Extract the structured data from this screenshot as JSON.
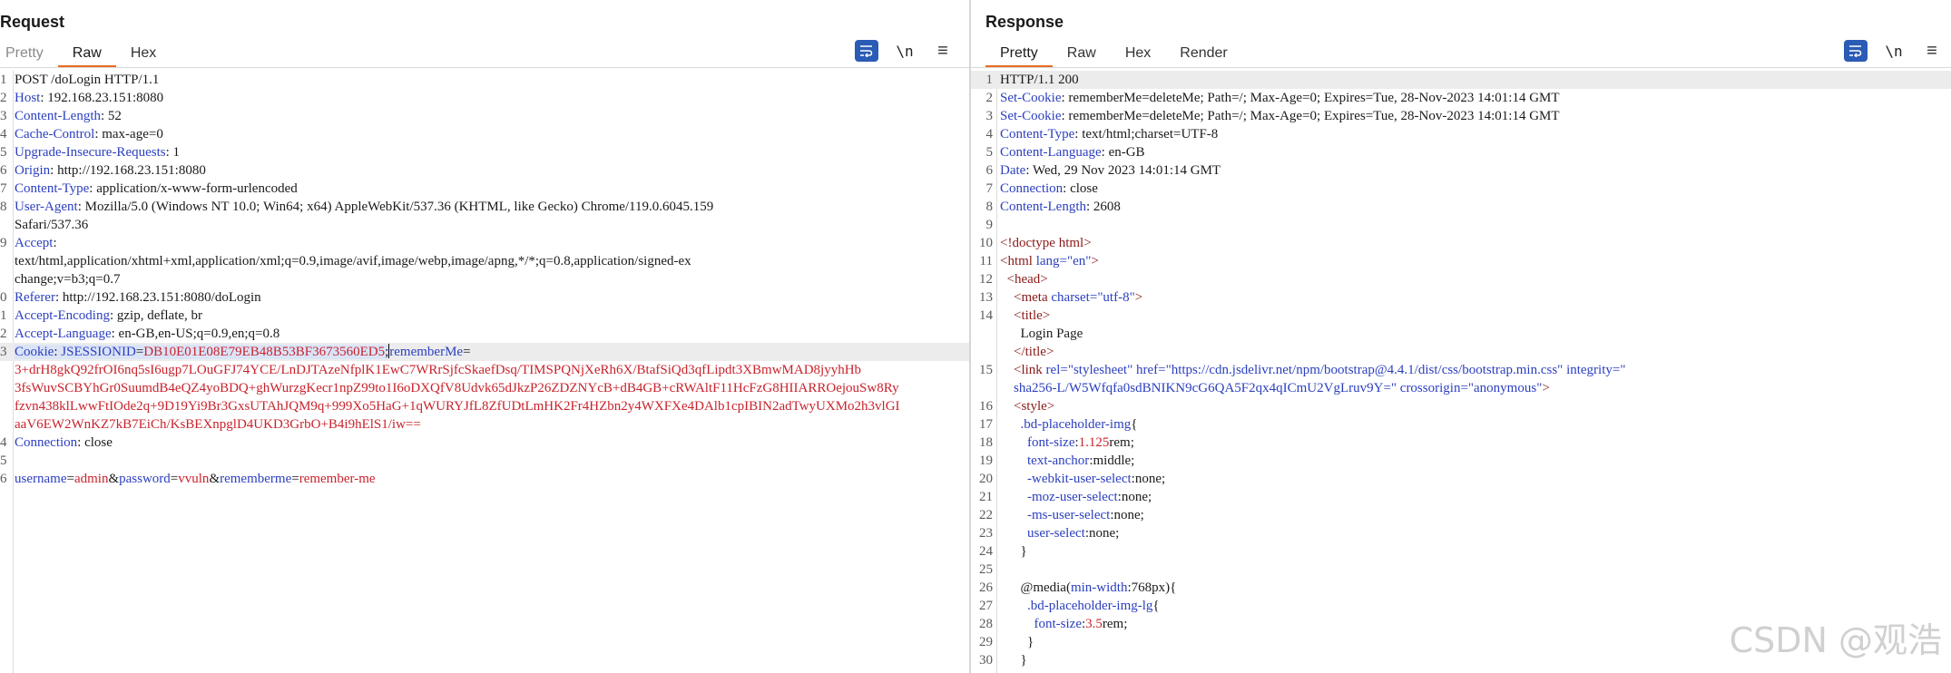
{
  "request": {
    "title": "Request",
    "tabs": [
      "Pretty",
      "Raw",
      "Hex"
    ],
    "active_tab": "Raw",
    "lines": [
      {
        "n": "1",
        "name": "",
        "sep": "",
        "value": "POST /doLogin HTTP/1.1"
      },
      {
        "n": "2",
        "name": "Host",
        "sep": ": ",
        "value": "192.168.23.151:8080"
      },
      {
        "n": "3",
        "name": "Content-Length",
        "sep": ": ",
        "value": "52"
      },
      {
        "n": "4",
        "name": "Cache-Control",
        "sep": ": ",
        "value": "max-age=0"
      },
      {
        "n": "5",
        "name": "Upgrade-Insecure-Requests",
        "sep": ": ",
        "value": "1"
      },
      {
        "n": "6",
        "name": "Origin",
        "sep": ": ",
        "value": "http://192.168.23.151:8080"
      },
      {
        "n": "7",
        "name": "Content-Type",
        "sep": ": ",
        "value": "application/x-www-form-urlencoded"
      },
      {
        "n": "8",
        "name": "User-Agent",
        "sep": ": ",
        "value": "Mozilla/5.0 (Windows NT 10.0; Win64; x64) AppleWebKit/537.36 (KHTML, like Gecko) Chrome/119.0.6045.159"
      },
      {
        "n": "",
        "name": "",
        "sep": "",
        "value": "Safari/537.36"
      },
      {
        "n": "9",
        "name": "Accept",
        "sep": ":",
        "value": ""
      },
      {
        "n": "",
        "name": "",
        "sep": "",
        "value": "text/html,application/xhtml+xml,application/xml;q=0.9,image/avif,image/webp,image/apng,*/*;q=0.8,application/signed-ex"
      },
      {
        "n": "",
        "name": "",
        "sep": "",
        "value": "change;v=b3;q=0.7"
      },
      {
        "n": "0",
        "name": "Referer",
        "sep": ": ",
        "value": "http://192.168.23.151:8080/doLogin"
      },
      {
        "n": "1",
        "name": "Accept-Encoding",
        "sep": ": ",
        "value": "gzip, deflate, br"
      },
      {
        "n": "2",
        "name": "Accept-Language",
        "sep": ": ",
        "value": "en-GB,en-US;q=0.9,en;q=0.8"
      }
    ],
    "cookie": {
      "n": "3",
      "name": "Cookie",
      "sep": ": ",
      "session_key": "JSESSIONID",
      "session_value": "DB10E01E08E79EB48B53BF3673560ED5",
      "remember_key": "rememberMe",
      "continuation": [
        "3+drH8gkQ92frOI6nq5sI6ugp7LOuGFJ74YCE/LnDJTAzeNfplK1EwC7WRrSjfcSkaefDsq/TIMSPQNjXeRh6X/BtafSiQd3qfLipdt3XBmwMAD8jyyhHb",
        "3fsWuvSCBYhGr0SuumdB4eQZ4yoBDQ+ghWurzgKecr1npZ99to1I6oDXQfV8Udvk65dJkzP26ZDZNYcB+dB4GB+cRWAltF11HcFzG8HIIARROejouSw8Ry",
        "fzvn438klLwwFtIOde2q+9D19Yi9Br3GxsUTAhJQM9q+999Xo5HaG+1qWURYJfL8ZfUDtLmHK2Fr4HZbn2y4WXFXe4DAlb1cpIBIN2adTwyUXMo2h3vlGI",
        "aaV6EW2WnKZ7kB7EiCh/KsBEXnpglD4UKD3GrbO+B4i9hElS1/iw=="
      ]
    },
    "after_cookie": [
      {
        "n": "4",
        "name": "Connection",
        "sep": ": ",
        "value": "close"
      },
      {
        "n": "5",
        "name": "",
        "sep": "",
        "value": ""
      }
    ],
    "body_line": {
      "n": "6",
      "k1": "username",
      "v1": "admin",
      "k2": "password",
      "v2": "vvuln",
      "k3": "rememberme",
      "v3": "remember-me"
    }
  },
  "response": {
    "title": "Response",
    "tabs": [
      "Pretty",
      "Raw",
      "Hex",
      "Render"
    ],
    "active_tab": "Pretty",
    "headers": [
      {
        "n": "1",
        "name": "",
        "sep": "",
        "value": "HTTP/1.1 200"
      },
      {
        "n": "2",
        "name": "Set-Cookie",
        "sep": ": ",
        "value": "rememberMe=deleteMe; Path=/; Max-Age=0; Expires=Tue, 28-Nov-2023 14:01:14 GMT"
      },
      {
        "n": "3",
        "name": "Set-Cookie",
        "sep": ": ",
        "value": "rememberMe=deleteMe; Path=/; Max-Age=0; Expires=Tue, 28-Nov-2023 14:01:14 GMT"
      },
      {
        "n": "4",
        "name": "Content-Type",
        "sep": ": ",
        "value": "text/html;charset=UTF-8"
      },
      {
        "n": "5",
        "name": "Content-Language",
        "sep": ": ",
        "value": "en-GB"
      },
      {
        "n": "6",
        "name": "Date",
        "sep": ": ",
        "value": "Wed, 29 Nov 2023 14:01:14 GMT"
      },
      {
        "n": "7",
        "name": "Connection",
        "sep": ": ",
        "value": "close"
      },
      {
        "n": "8",
        "name": "Content-Length",
        "sep": ": ",
        "value": "2608"
      },
      {
        "n": "9",
        "name": "",
        "sep": "",
        "value": ""
      }
    ],
    "html_lines": [
      {
        "n": "10",
        "indent": "",
        "parts": [
          [
            "tag",
            "<!doctype html>"
          ]
        ]
      },
      {
        "n": "11",
        "indent": "",
        "parts": [
          [
            "tag",
            "<html "
          ],
          [
            "attr",
            "lang="
          ],
          [
            "str",
            "\"en\""
          ],
          [
            "tag",
            ">"
          ]
        ]
      },
      {
        "n": "12",
        "indent": "  ",
        "parts": [
          [
            "tag",
            "<head>"
          ]
        ]
      },
      {
        "n": "13",
        "indent": "    ",
        "parts": [
          [
            "tag",
            "<meta "
          ],
          [
            "attr",
            "charset="
          ],
          [
            "str",
            "\"utf-8\""
          ],
          [
            "tag",
            ">"
          ]
        ]
      },
      {
        "n": "14",
        "indent": "    ",
        "parts": [
          [
            "tag",
            "<title>"
          ]
        ]
      },
      {
        "n": "",
        "indent": "      ",
        "parts": [
          [
            "v",
            "Login Page"
          ]
        ]
      },
      {
        "n": "",
        "indent": "    ",
        "parts": [
          [
            "tag",
            "</title>"
          ]
        ]
      },
      {
        "n": "15",
        "indent": "    ",
        "parts": [
          [
            "tag",
            "<link "
          ],
          [
            "attr",
            "rel="
          ],
          [
            "str",
            "\"stylesheet\" "
          ],
          [
            "attr",
            "href="
          ],
          [
            "str",
            "\"https://cdn.jsdelivr.net/npm/bootstrap@4.4.1/dist/css/bootstrap.min.css\" "
          ],
          [
            "attr",
            "integrity="
          ],
          [
            "str",
            "\""
          ]
        ]
      },
      {
        "n": "",
        "indent": "    ",
        "parts": [
          [
            "str",
            "sha256-L/W5Wfqfa0sdBNIKN9cG6QA5F2qx4qICmU2VgLruv9Y=\" "
          ],
          [
            "attr",
            "crossorigin="
          ],
          [
            "str",
            "\"anonymous\""
          ],
          [
            "tag",
            ">"
          ]
        ]
      },
      {
        "n": "16",
        "indent": "    ",
        "parts": [
          [
            "tag",
            "<style>"
          ]
        ]
      },
      {
        "n": "17",
        "indent": "      ",
        "parts": [
          [
            "attr",
            ".bd-placeholder-img"
          ],
          [
            "v",
            "{"
          ]
        ]
      },
      {
        "n": "18",
        "indent": "        ",
        "parts": [
          [
            "attr",
            "font-size"
          ],
          [
            "v",
            ":"
          ],
          [
            "red",
            "1.125"
          ],
          [
            "v",
            "rem;"
          ]
        ]
      },
      {
        "n": "19",
        "indent": "        ",
        "parts": [
          [
            "attr",
            "text-anchor"
          ],
          [
            "v",
            ":middle;"
          ]
        ]
      },
      {
        "n": "20",
        "indent": "        ",
        "parts": [
          [
            "attr",
            "-webkit-user-select"
          ],
          [
            "v",
            ":none;"
          ]
        ]
      },
      {
        "n": "21",
        "indent": "        ",
        "parts": [
          [
            "attr",
            "-moz-user-select"
          ],
          [
            "v",
            ":none;"
          ]
        ]
      },
      {
        "n": "22",
        "indent": "        ",
        "parts": [
          [
            "attr",
            "-ms-user-select"
          ],
          [
            "v",
            ":none;"
          ]
        ]
      },
      {
        "n": "23",
        "indent": "        ",
        "parts": [
          [
            "attr",
            "user-select"
          ],
          [
            "v",
            ":none;"
          ]
        ]
      },
      {
        "n": "24",
        "indent": "      ",
        "parts": [
          [
            "v",
            "}"
          ]
        ]
      },
      {
        "n": "25",
        "indent": "",
        "parts": []
      },
      {
        "n": "26",
        "indent": "      ",
        "parts": [
          [
            "v",
            "@media("
          ],
          [
            "attr",
            "min-width"
          ],
          [
            "v",
            ":768px){"
          ]
        ]
      },
      {
        "n": "27",
        "indent": "        ",
        "parts": [
          [
            "attr",
            ".bd-placeholder-img-lg"
          ],
          [
            "v",
            "{"
          ]
        ]
      },
      {
        "n": "28",
        "indent": "          ",
        "parts": [
          [
            "attr",
            "font-size"
          ],
          [
            "v",
            ":"
          ],
          [
            "red",
            "3.5"
          ],
          [
            "v",
            "rem;"
          ]
        ]
      },
      {
        "n": "29",
        "indent": "        ",
        "parts": [
          [
            "v",
            "}"
          ]
        ]
      },
      {
        "n": "30",
        "indent": "      ",
        "parts": [
          [
            "v",
            "}"
          ]
        ]
      }
    ]
  },
  "toolbar": {
    "newline_label": "\\n",
    "menu_label": "≡"
  },
  "watermark": "CSDN @观浩"
}
